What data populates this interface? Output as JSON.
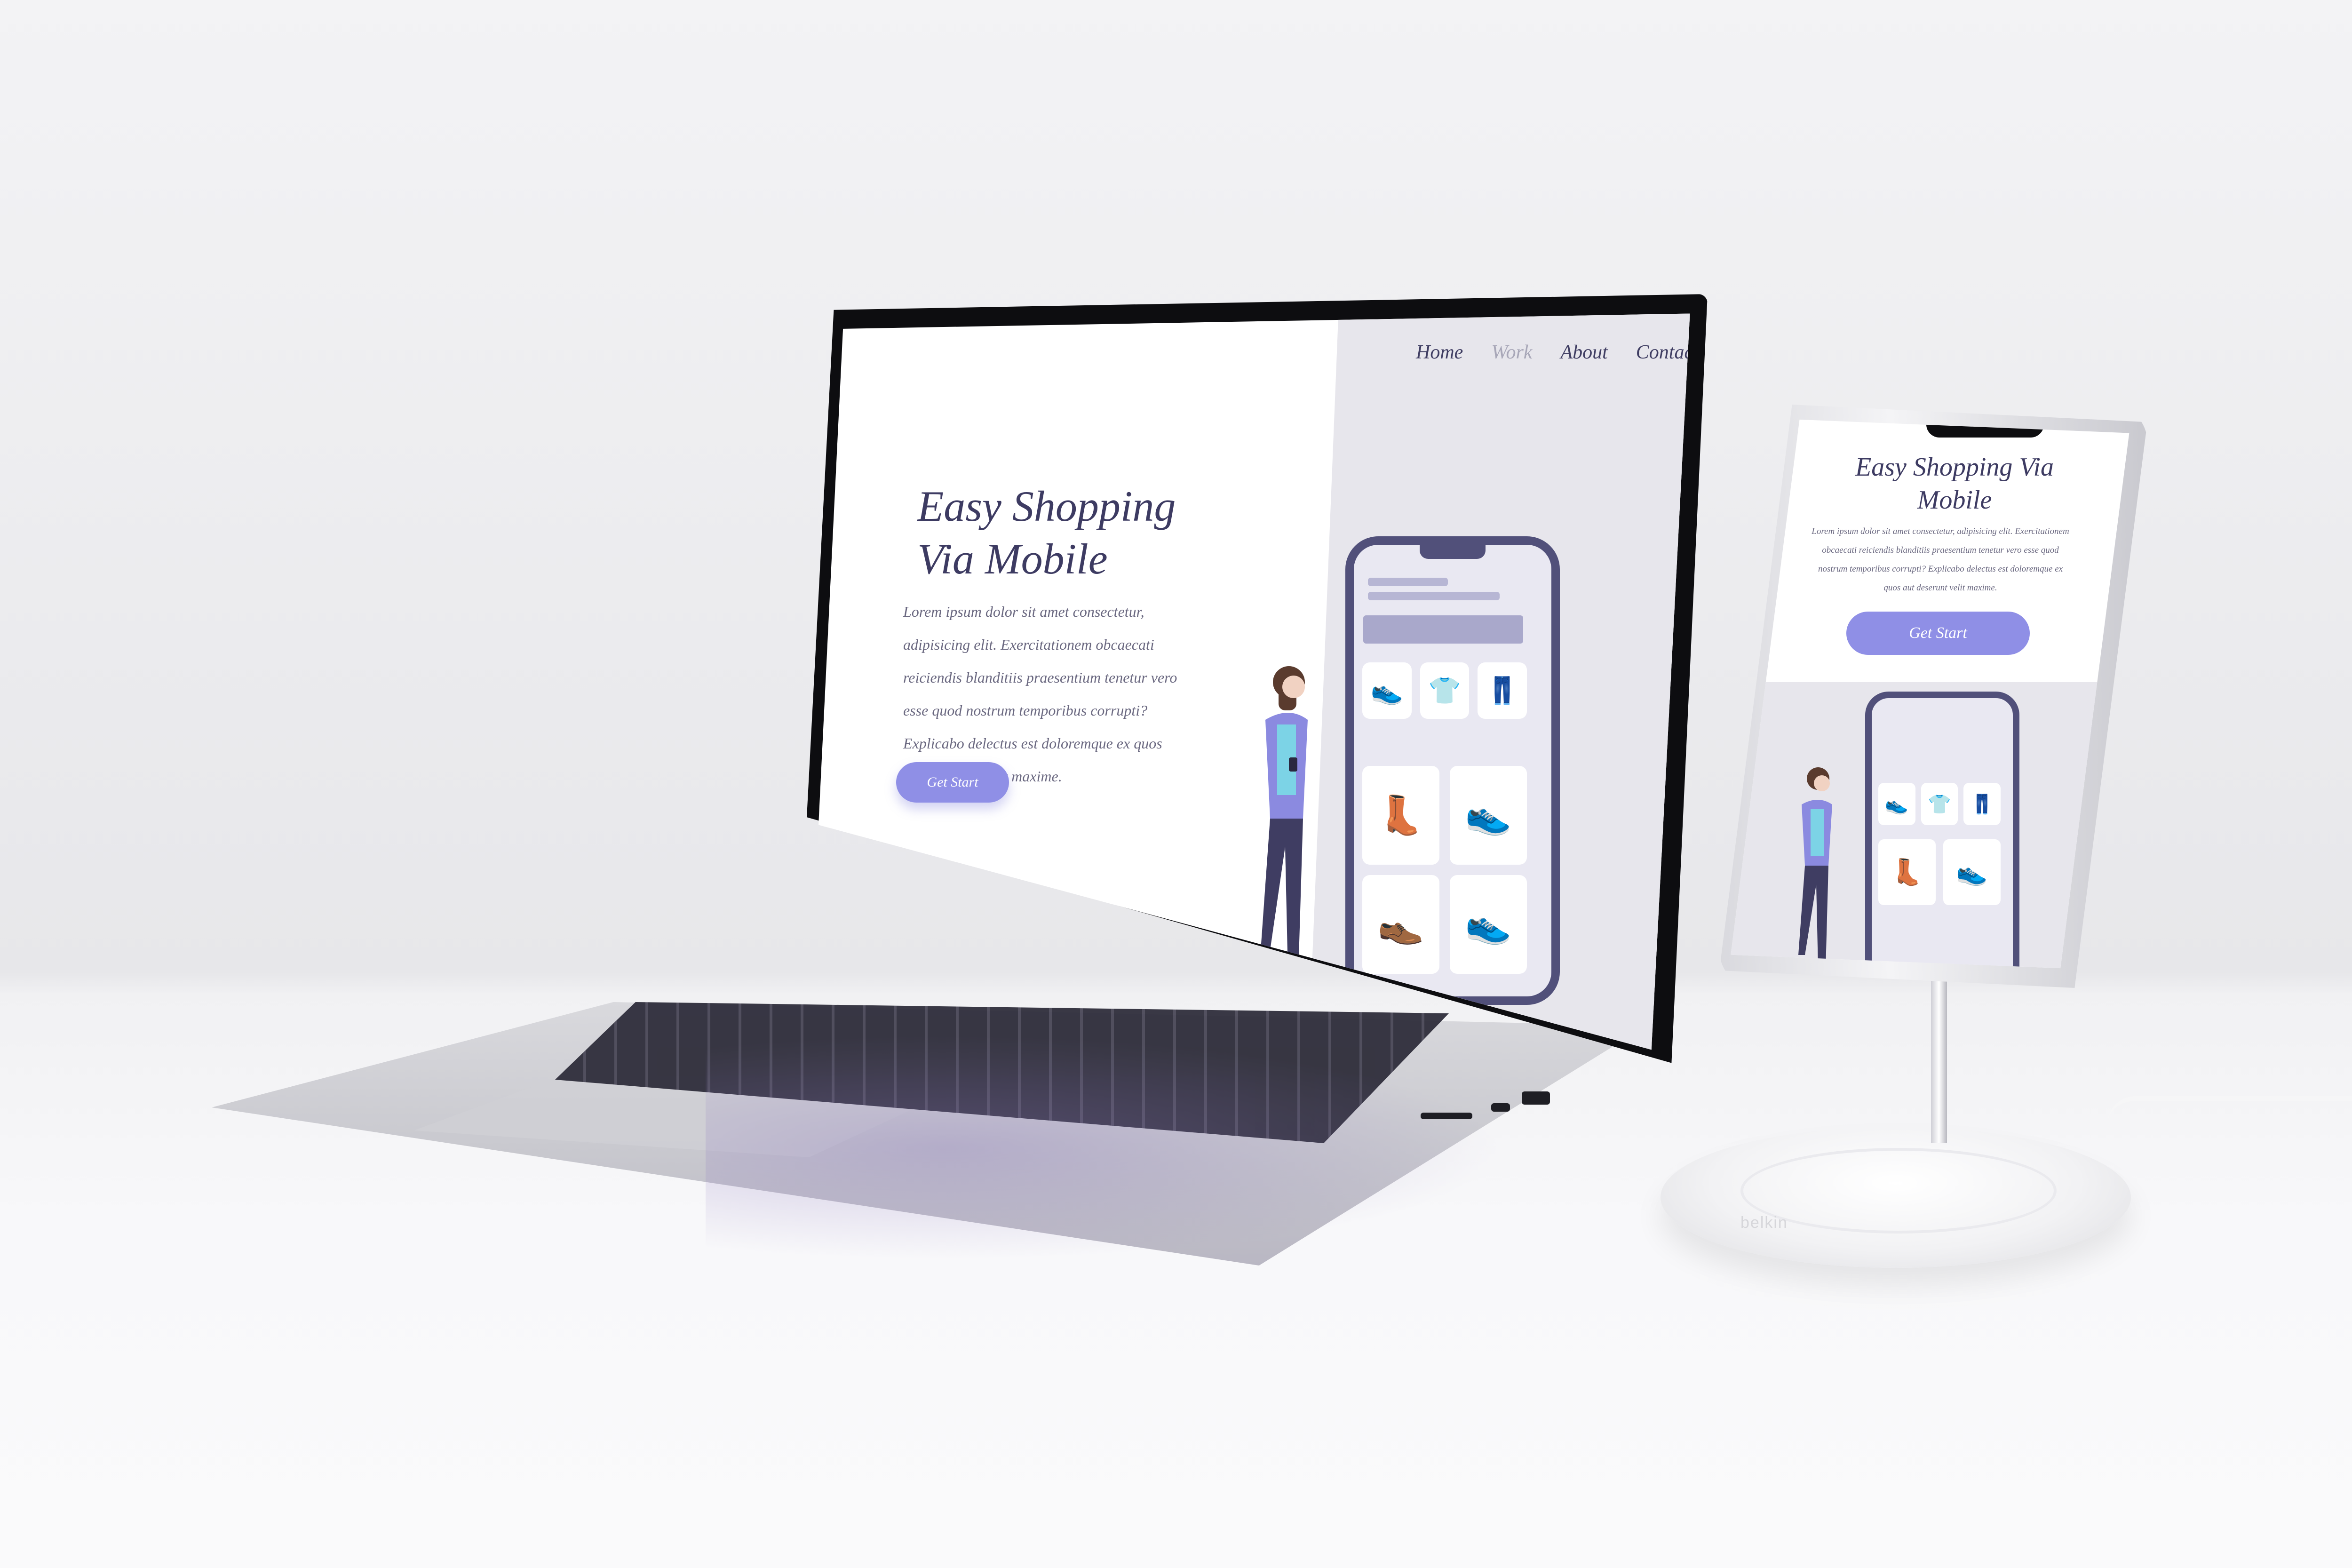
{
  "laptop_site": {
    "nav": [
      "Home",
      "Work",
      "About",
      "Contact"
    ],
    "title_line1": "Easy Shopping",
    "title_line2": "Via Mobile",
    "body": "Lorem ipsum dolor sit amet consectetur, adipisicing elit. Exercitationem obcaecati reiciendis blanditiis praesentium tenetur vero esse quod nostrum temporibus corrupti? Explicabo delectus est doloremque ex quos aut deserunt velit maxime.",
    "button": "Get Start"
  },
  "phone_site": {
    "title": "Easy Shopping Via Mobile",
    "body": "Lorem ipsum dolor sit amet consectetur, adipisicing elit. Exercitationem obcaecati reiciendis blanditiis praesentium tenetur vero esse quod nostrum temporibus corrupti? Explicabo delectus est doloremque ex quos aut deserunt velit maxime.",
    "button": "Get Start"
  },
  "icons": {
    "shoe": "shoe-icon",
    "shirt": "shirt-icon",
    "pants": "pants-icon",
    "heel": "heel-icon"
  },
  "colors": {
    "accent": "#8f8fe6",
    "heading": "#3d3b62",
    "panel": "#e7e6ec",
    "device_ink": "#51507a"
  },
  "stand_brand": "belkin"
}
